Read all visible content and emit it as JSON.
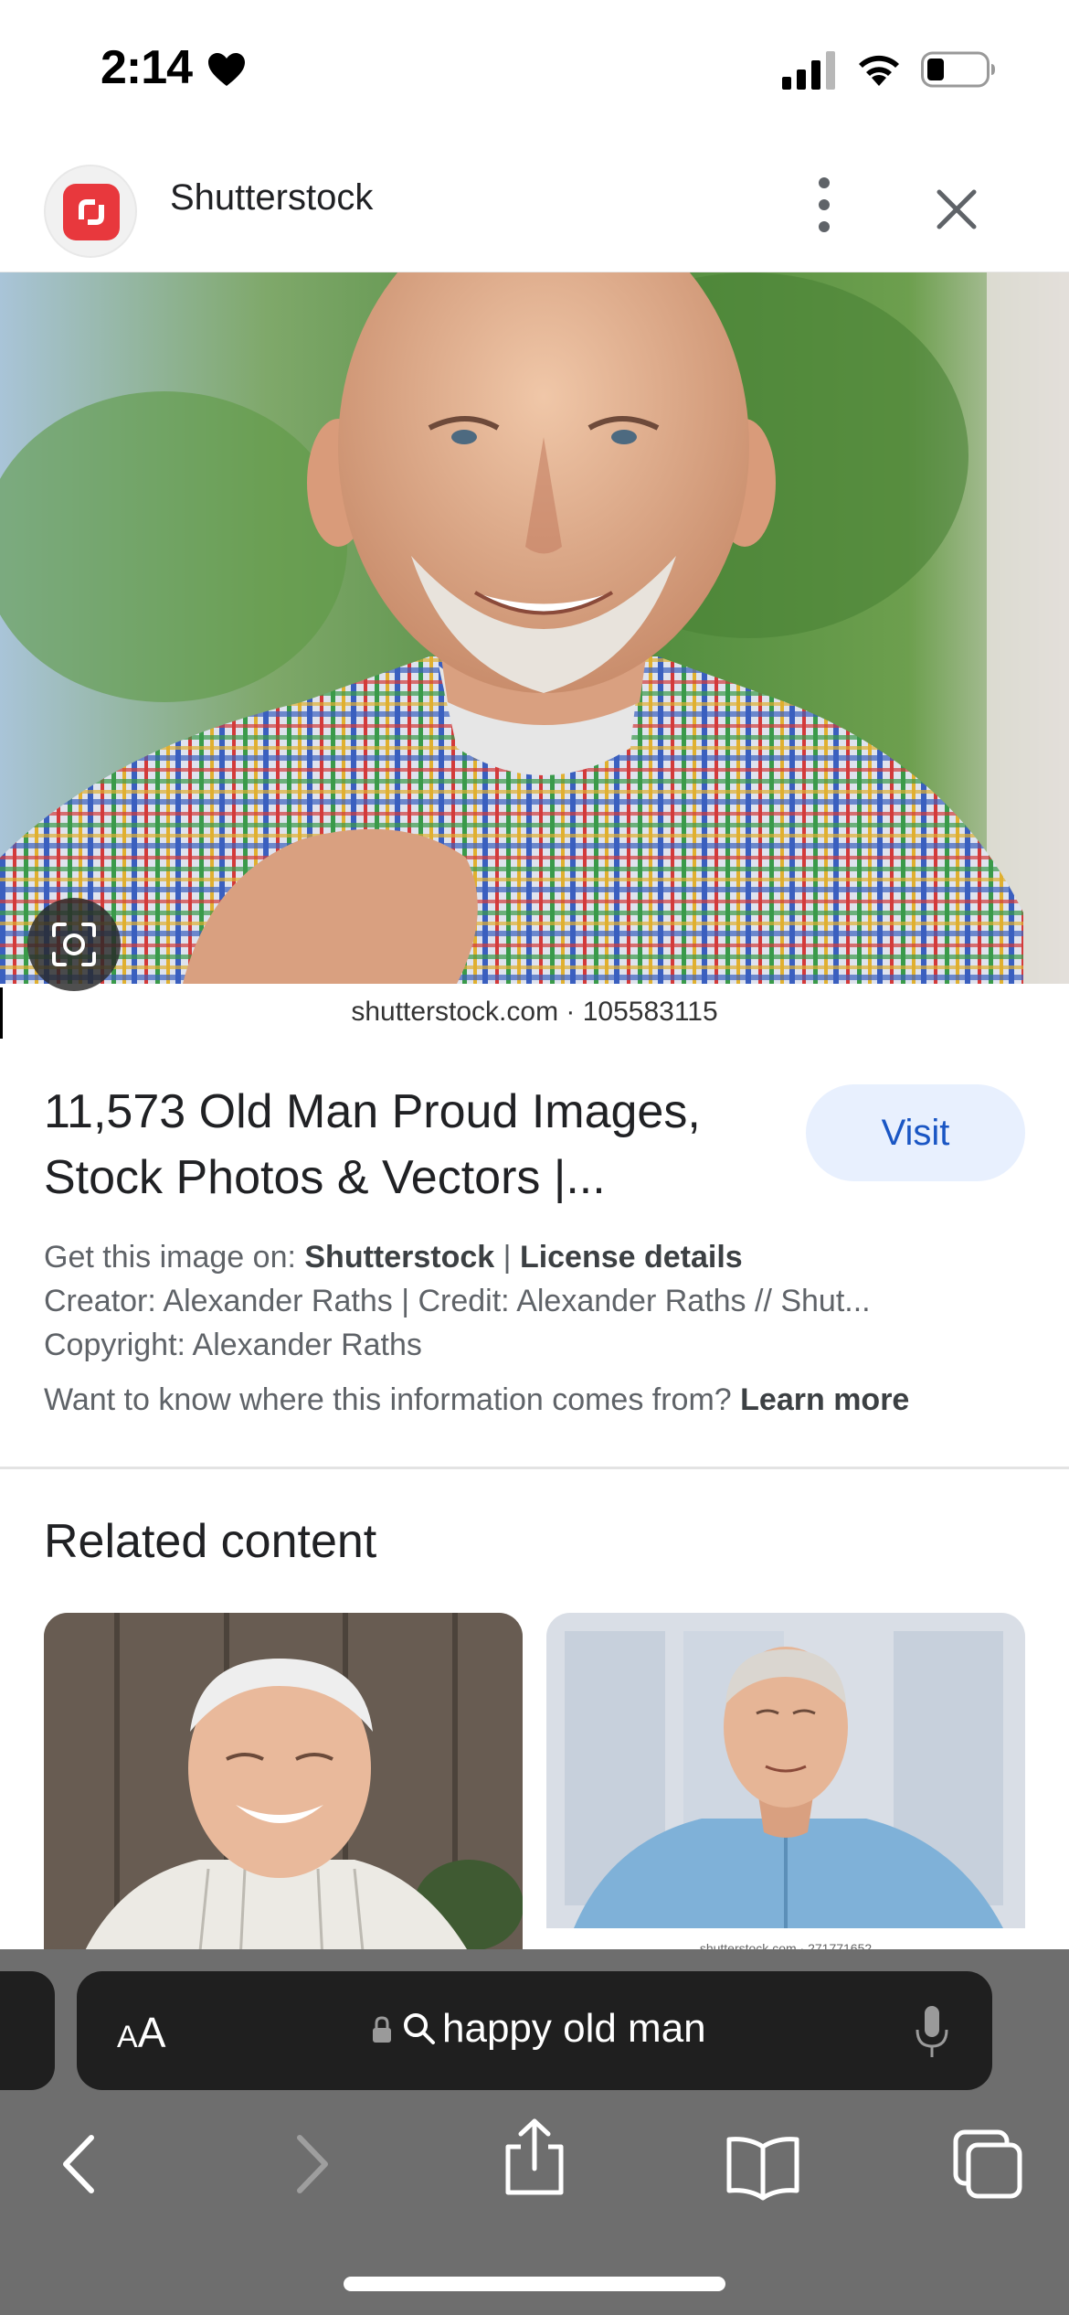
{
  "status_bar": {
    "time": "2:14",
    "icons": [
      "heart-icon",
      "cellular-signal-icon",
      "wifi-icon",
      "battery-icon"
    ]
  },
  "header": {
    "site_name": "Shutterstock",
    "logo_icon": "shutterstock-logo-icon",
    "more_icon": "more-vertical-icon",
    "close_icon": "close-icon"
  },
  "image": {
    "caption": "shutterstock.com · 105583115",
    "lens_icon": "lens-icon"
  },
  "result": {
    "title": "11,573 Old Man Proud Images, Stock Photos & Vectors |...",
    "visit_label": "Visit",
    "get_image_prefix": "Get this image on: ",
    "source_name": "Shutterstock",
    "separator": " | ",
    "license_label": "License details",
    "creator_line": "Creator: Alexander Raths | Credit: Alexander Raths // Shut...",
    "copyright_line": "Copyright: Alexander Raths",
    "info_question": "Want to know where this information comes from? ",
    "learn_more": "Learn more"
  },
  "related": {
    "title": "Related content",
    "thumb2_caption": "shutterstock.com · 271771652"
  },
  "toolbar": {
    "text_size_label_small": "A",
    "text_size_label_large": "A",
    "url_text": "happy old man",
    "icons": [
      "lock-icon",
      "search-icon",
      "microphone-icon",
      "back-icon",
      "forward-icon",
      "share-icon",
      "bookmarks-icon",
      "tabs-icon"
    ]
  },
  "colors": {
    "accent": "#1a56c4",
    "visit_bg": "#e8f0fe",
    "logo_red": "#e8383d",
    "toolbar_bg": "#6e6e6e",
    "address_bg": "#1f1f1f"
  }
}
